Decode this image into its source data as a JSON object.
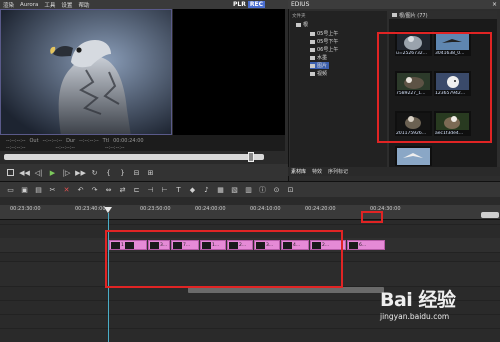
{
  "menu": {
    "items": [
      "渲染",
      "Aurora",
      "工具",
      "设置",
      "帮助"
    ],
    "plr": "PLR",
    "rec": "REC"
  },
  "preview": {
    "timecode_row1": [
      "--:--:--:--",
      "Out",
      "--:--:--:--",
      "Dur",
      "--:--:--:--",
      "Ttl",
      "00:00:24:00"
    ],
    "timecode_row2": [
      "--:--:--:--",
      "--:--:--:--",
      "--:--:--:--"
    ]
  },
  "bin": {
    "window_title": "EDIUS",
    "window_close": "×",
    "tree_header": "文件夹",
    "tree_root": "根",
    "tree_items": [
      "05号上午",
      "05号下午",
      "06号上午",
      "水墨",
      "图片",
      "视频"
    ],
    "selected_tree_item": "图片",
    "content_header": "根/图片 (77)",
    "thumbnails": [
      {
        "caption": "u=2526732..."
      },
      {
        "caption": "3041638_0..."
      },
      {
        "caption": "7589227_1..."
      },
      {
        "caption": "123657942..."
      },
      {
        "caption": "201175926..."
      },
      {
        "caption": "aec1f3de4..."
      },
      {
        "caption": ""
      }
    ],
    "tabs": [
      "素材库",
      "特效",
      "序列标记"
    ],
    "active_tab": "素材库"
  },
  "timeline": {
    "ticks": [
      "00:23:30:00",
      "00:23:40:00",
      "00:23:50:00",
      "00:24:00:00",
      "00:24:10:00",
      "00:24:20:00",
      "00:24:30:00"
    ],
    "clips": [
      {
        "label": "1"
      },
      {
        "label": "3..."
      },
      {
        "label": "7..."
      },
      {
        "label": "1..."
      },
      {
        "label": "2..."
      },
      {
        "label": "3..."
      },
      {
        "label": "4..."
      },
      {
        "label": "2..."
      },
      {
        "label": "6..."
      }
    ]
  },
  "watermark": {
    "brand": "Bai 经验",
    "url": "jingyan.baidu.com"
  },
  "colors": {
    "highlight": "#e02424",
    "clip": "#e58ad6",
    "cursor": "#4aaec8"
  }
}
